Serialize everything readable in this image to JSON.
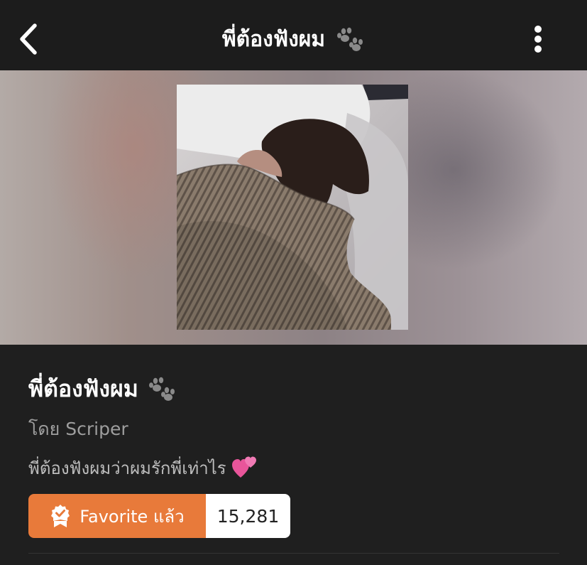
{
  "header": {
    "title": "พี่ต้องฟังผม",
    "back_icon": "chevron-left-icon",
    "menu_icon": "more-vertical-icon",
    "title_emoji_icon": "paw-prints-icon"
  },
  "story": {
    "title": "พี่ต้องฟังผม",
    "author": "โดย Scriper",
    "description": "พี่ต้องฟังผมว่าผมรักพี่เท่าไร",
    "description_emoji_icon": "two-hearts-icon"
  },
  "favorite": {
    "label": "Favorite แล้ว",
    "count": "15,281",
    "icon": "bookmark-check-icon"
  },
  "colors": {
    "background": "#1f1f1f",
    "accent": "#e87a3a",
    "secondary_text": "#9e9e9e"
  }
}
